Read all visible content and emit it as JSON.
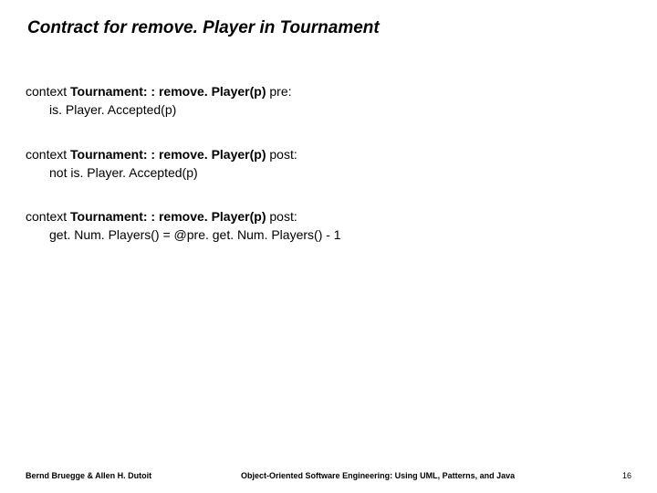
{
  "title": "Contract for remove. Player  in Tournament",
  "blocks": [
    {
      "ctx_prefix": "context ",
      "ctx_bold": "Tournament: : remove. Player(p) ",
      "ctx_suffix": "pre:",
      "body": "is. Player. Accepted(p)"
    },
    {
      "ctx_prefix": "context ",
      "ctx_bold": "Tournament: : remove. Player(p) ",
      "ctx_suffix": "post:",
      "body": "not is. Player. Accepted(p)"
    },
    {
      "ctx_prefix": "context ",
      "ctx_bold": "Tournament: : remove. Player(p) ",
      "ctx_suffix": "post:",
      "body": "get. Num. Players() = @pre. get. Num. Players() - 1"
    }
  ],
  "footer": {
    "left": "Bernd Bruegge & Allen H. Dutoit",
    "center": "Object-Oriented Software Engineering: Using UML, Patterns, and Java",
    "page": "16"
  }
}
